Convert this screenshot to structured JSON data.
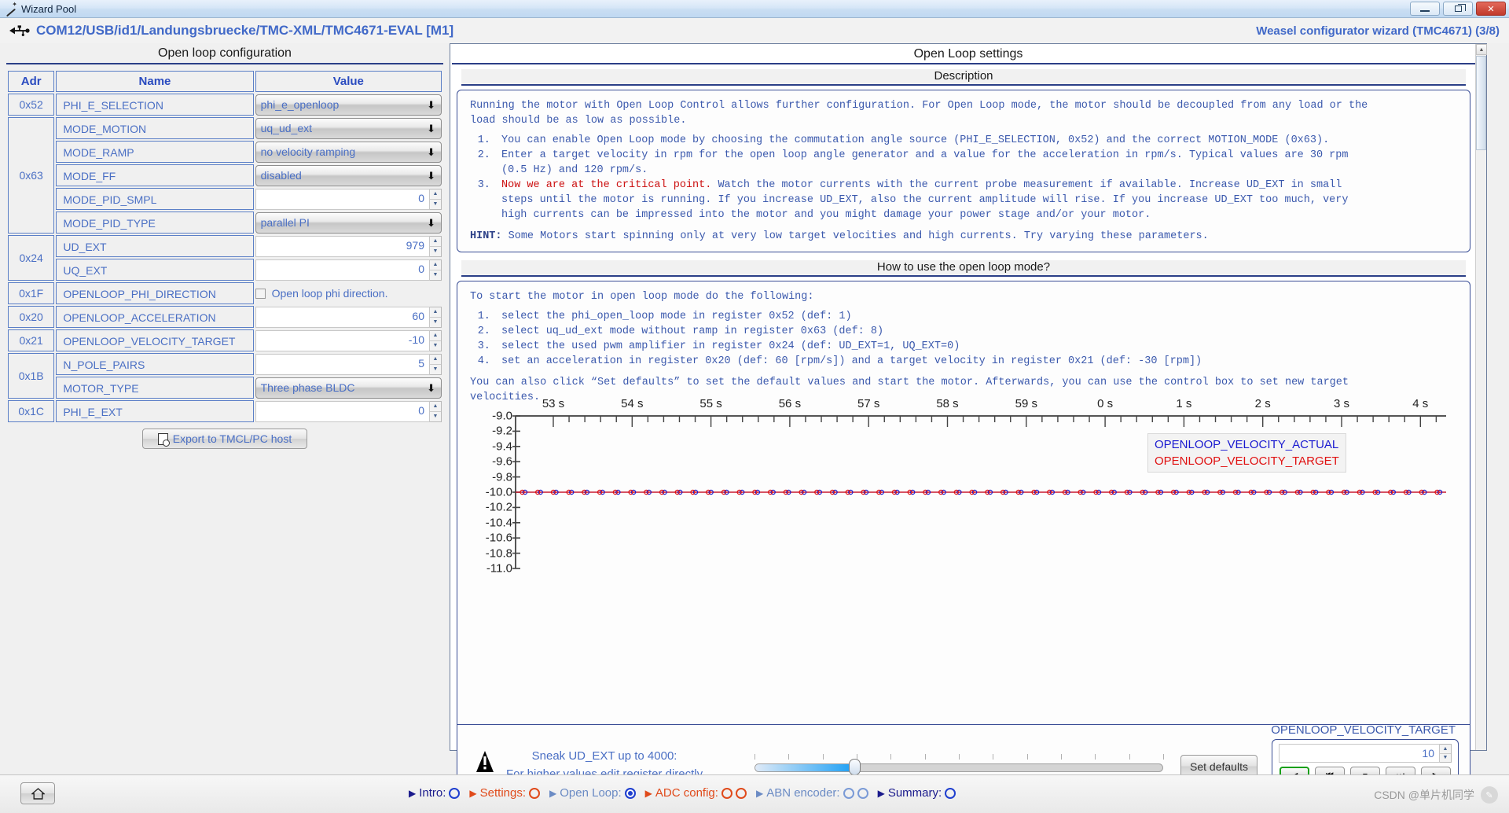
{
  "window": {
    "title": "Wizard Pool",
    "icon": "wand-icon",
    "minimize": "minimize-icon",
    "maximize": "restore-icon",
    "close": "✕"
  },
  "header": {
    "device_path": "COM12/USB/id1/Landungsbruecke/TMC-XML/TMC4671-EVAL [M1]",
    "wizard_label": "Weasel configurator wizard (TMC4671) (3/8)"
  },
  "left_panel": {
    "title": "Open loop configuration",
    "columns": [
      "Adr",
      "Name",
      "Value"
    ],
    "rows": [
      {
        "adr": "0x52",
        "rowspan": 1,
        "name": "PHI_E_SELECTION",
        "type": "combo",
        "value": "phi_e_openloop"
      },
      {
        "adr": "0x63",
        "rowspan": 5,
        "name": "MODE_MOTION",
        "type": "combo",
        "value": "uq_ud_ext"
      },
      {
        "adr": "",
        "rowspan": 0,
        "name": "MODE_RAMP",
        "type": "combo",
        "value": "no velocity ramping"
      },
      {
        "adr": "",
        "rowspan": 0,
        "name": "MODE_FF",
        "type": "combo",
        "value": "disabled"
      },
      {
        "adr": "",
        "rowspan": 0,
        "name": "MODE_PID_SMPL",
        "type": "spin",
        "value": "0"
      },
      {
        "adr": "",
        "rowspan": 0,
        "name": "MODE_PID_TYPE",
        "type": "combo",
        "value": "parallel PI"
      },
      {
        "adr": "0x24",
        "rowspan": 2,
        "name": "UD_EXT",
        "type": "spin",
        "value": "979"
      },
      {
        "adr": "",
        "rowspan": 0,
        "name": "UQ_EXT",
        "type": "spin",
        "value": "0"
      },
      {
        "adr": "0x1F",
        "rowspan": 1,
        "name": "OPENLOOP_PHI_DIRECTION",
        "type": "check",
        "value": "Open loop phi direction.",
        "checked": false
      },
      {
        "adr": "0x20",
        "rowspan": 1,
        "name": "OPENLOOP_ACCELERATION",
        "type": "spin",
        "value": "60"
      },
      {
        "adr": "0x21",
        "rowspan": 1,
        "name": "OPENLOOP_VELOCITY_TARGET",
        "type": "spin",
        "value": "-10"
      },
      {
        "adr": "0x1B",
        "rowspan": 2,
        "name": "N_POLE_PAIRS",
        "type": "spin",
        "value": "5"
      },
      {
        "adr": "",
        "rowspan": 0,
        "name": "MOTOR_TYPE",
        "type": "combo",
        "value": "Three phase BLDC"
      },
      {
        "adr": "0x1C",
        "rowspan": 1,
        "name": "PHI_E_EXT",
        "type": "spin",
        "value": "0"
      }
    ],
    "export_button": "Export to TMCL/PC host"
  },
  "right_panel": {
    "title": "Open Loop settings",
    "description": {
      "title": "Description",
      "intro": "Running the motor with Open Loop Control allows further configuration. For Open Loop mode, the motor should be decoupled from any load or the\nload should be as low as possible.",
      "items": [
        "You can enable Open Loop mode by choosing the commutation angle source (PHI_E_SELECTION, 0x52) and the correct MOTION_MODE (0x63).",
        "Enter a target velocity in rpm for the open loop angle generator and a value for the acceleration in rpm/s. Typical values are 30 rpm\n(0.5 Hz) and 120 rpm/s.",
        "Now we are at the critical point. Watch the motor currents with the current probe measurement if available. Increase UD_EXT in small\nsteps until the motor is running. If you increase UD_EXT, also the current amplitude will rise. If you increase UD_EXT too much, very\nhigh currents can be impressed into the motor and you might damage your power stage and/or your motor."
      ],
      "item3_red": "Now we are at the critical point.",
      "hint_label": "HINT:",
      "hint_text": " Some Motors start spinning only at very low target velocities and high currents. Try varying these parameters."
    },
    "howto": {
      "title": "How to use the open loop mode?",
      "intro": "To start the motor in open loop mode do the following:",
      "items": [
        "select the phi_open_loop mode in register 0x52 (def: 1)",
        "select uq_ud_ext mode without ramp in register 0x63 (def: 8)",
        "select the used pwm amplifier in register 0x24 (def: UD_EXT=1, UQ_EXT=0)",
        "set an acceleration in register 0x20 (def: 60 [rpm/s]) and a target velocity in register 0x21 (def: -30 [rpm])"
      ],
      "outro": "You can also click “Set defaults” to set the default values and start the motor. Afterwards, you can use the control box to set new target\nvelocities."
    },
    "controls": {
      "warning_icon": "warning-icon",
      "sneak_line1": "Sneak UD_EXT up to 4000:",
      "sneak_line2": "For higher values edit register directly",
      "slider_value": 979,
      "slider_min": 0,
      "slider_max": 4000,
      "set_defaults": "Set defaults",
      "target_label": "OPENLOOP_VELOCITY_TARGET",
      "target_value": "10",
      "transport": [
        {
          "name": "rewind-button",
          "glyph": "◀",
          "active": true
        },
        {
          "name": "step-back-button",
          "glyph": "⏮",
          "active": false
        },
        {
          "name": "stop-button",
          "glyph": "■",
          "active": false
        },
        {
          "name": "step-forward-button",
          "glyph": "⏭",
          "active": false
        },
        {
          "name": "play-button",
          "glyph": "▶",
          "active": false
        }
      ]
    }
  },
  "chart_data": {
    "type": "line",
    "title": "",
    "xlabel": "",
    "ylabel": "",
    "x_tick_labels": [
      "53 s",
      "54 s",
      "55 s",
      "56 s",
      "57 s",
      "58 s",
      "59 s",
      "0 s",
      "1 s",
      "2 s",
      "3 s",
      "4 s"
    ],
    "y_tick_labels": [
      "-9.0",
      "-9.2",
      "-9.4",
      "-9.6",
      "-9.8",
      "-10.0",
      "-10.2",
      "-10.4",
      "-10.6",
      "-10.8",
      "-11.0"
    ],
    "ylim": [
      -11.0,
      -9.0
    ],
    "grid": false,
    "legend_position": "top-right",
    "series": [
      {
        "name": "OPENLOOP_VELOCITY_ACTUAL",
        "color": "#1a1ad0",
        "constant_value": -10.0,
        "n_points": 60
      },
      {
        "name": "OPENLOOP_VELOCITY_TARGET",
        "color": "#e01010",
        "constant_value": -10.0,
        "n_points": 60
      }
    ]
  },
  "status_bar": {
    "home_icon": "home-icon",
    "steps": [
      {
        "label": "Intro:",
        "label_color": "#1a1a8c",
        "marker": "circle",
        "marker_color": "#1f3fcf"
      },
      {
        "label": "Settings:",
        "label_color": "#e04a1a",
        "marker": "circle",
        "marker_color": "#e04a1a"
      },
      {
        "label": "Open Loop:",
        "label_color": "#6b8bc4",
        "marker": "circle-filled",
        "marker_color": "#1f3fcf"
      },
      {
        "label": "ADC config:",
        "label_color": "#e04a1a",
        "marker": "circle",
        "marker_color": "#e04a1a",
        "extra_marker": true
      },
      {
        "label": "ABN encoder:",
        "label_color": "#6b8bc4",
        "marker": "circle",
        "marker_color": "#7a9ad6",
        "extra_marker": true
      },
      {
        "label": "Summary:",
        "label_color": "#1a1a8c",
        "marker": "circle",
        "marker_color": "#1f3fcf"
      }
    ],
    "watermark": "CSDN @单片机同学"
  }
}
